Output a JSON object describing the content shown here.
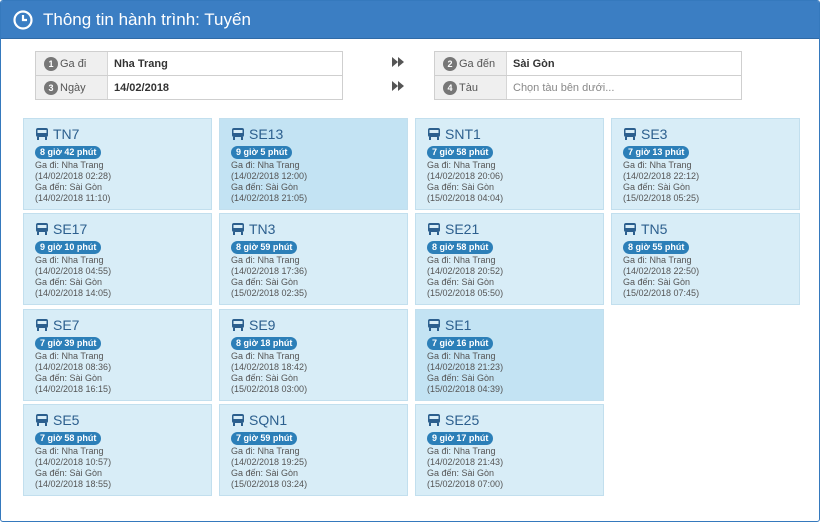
{
  "header": {
    "title": "Thông tin hành trình: Tuyến"
  },
  "form": {
    "from": {
      "num": "1",
      "label": "Ga đi",
      "value": "Nha Trang"
    },
    "to": {
      "num": "2",
      "label": "Ga đến",
      "value": "Sài Gòn"
    },
    "date": {
      "num": "3",
      "label": "Ngày",
      "value": "14/02/2018"
    },
    "train": {
      "num": "4",
      "label": "Tàu",
      "placeholder": "Chọn tàu bên dưới..."
    }
  },
  "cards": [
    {
      "name": "TN7",
      "duration": "8 giờ 42 phút",
      "dep_label": "Ga đi: Nha Trang",
      "dep_time": "(14/02/2018 02:28)",
      "arr_label": "Ga đến: Sài Gòn",
      "arr_time": "(14/02/2018 11:10)"
    },
    {
      "name": "SE13",
      "duration": "9 giờ 5 phút",
      "dep_label": "Ga đi: Nha Trang",
      "dep_time": "(14/02/2018 12:00)",
      "arr_label": "Ga đến: Sài Gòn",
      "arr_time": "(14/02/2018 21:05)"
    },
    {
      "name": "SNT1",
      "duration": "7 giờ 58 phút",
      "dep_label": "Ga đi: Nha Trang",
      "dep_time": "(14/02/2018 20:06)",
      "arr_label": "Ga đến: Sài Gòn",
      "arr_time": "(15/02/2018 04:04)"
    },
    {
      "name": "SE3",
      "duration": "7 giờ 13 phút",
      "dep_label": "Ga đi: Nha Trang",
      "dep_time": "(14/02/2018 22:12)",
      "arr_label": "Ga đến: Sài Gòn",
      "arr_time": "(15/02/2018 05:25)"
    },
    {
      "name": "SE17",
      "duration": "9 giờ 10 phút",
      "dep_label": "Ga đi: Nha Trang",
      "dep_time": "(14/02/2018 04:55)",
      "arr_label": "Ga đến: Sài Gòn",
      "arr_time": "(14/02/2018 14:05)"
    },
    {
      "name": "TN3",
      "duration": "8 giờ 59 phút",
      "dep_label": "Ga đi: Nha Trang",
      "dep_time": "(14/02/2018 17:36)",
      "arr_label": "Ga đến: Sài Gòn",
      "arr_time": "(15/02/2018 02:35)"
    },
    {
      "name": "SE21",
      "duration": "8 giờ 58 phút",
      "dep_label": "Ga đi: Nha Trang",
      "dep_time": "(14/02/2018 20:52)",
      "arr_label": "Ga đến: Sài Gòn",
      "arr_time": "(15/02/2018 05:50)"
    },
    {
      "name": "TN5",
      "duration": "8 giờ 55 phút",
      "dep_label": "Ga đi: Nha Trang",
      "dep_time": "(14/02/2018 22:50)",
      "arr_label": "Ga đến: Sài Gòn",
      "arr_time": "(15/02/2018 07:45)"
    },
    {
      "name": "SE7",
      "duration": "7 giờ 39 phút",
      "dep_label": "Ga đi: Nha Trang",
      "dep_time": "(14/02/2018 08:36)",
      "arr_label": "Ga đến: Sài Gòn",
      "arr_time": "(14/02/2018 16:15)"
    },
    {
      "name": "SE9",
      "duration": "8 giờ 18 phút",
      "dep_label": "Ga đi: Nha Trang",
      "dep_time": "(14/02/2018 18:42)",
      "arr_label": "Ga đến: Sài Gòn",
      "arr_time": "(15/02/2018 03:00)"
    },
    {
      "name": "SE1",
      "duration": "7 giờ 16 phút",
      "dep_label": "Ga đi: Nha Trang",
      "dep_time": "(14/02/2018 21:23)",
      "arr_label": "Ga đến: Sài Gòn",
      "arr_time": "(15/02/2018 04:39)"
    },
    {
      "name": "SE5",
      "duration": "7 giờ 58 phút",
      "dep_label": "Ga đi: Nha Trang",
      "dep_time": "(14/02/2018 10:57)",
      "arr_label": "Ga đến: Sài Gòn",
      "arr_time": "(14/02/2018 18:55)"
    },
    {
      "name": "SQN1",
      "duration": "7 giờ 59 phút",
      "dep_label": "Ga đi: Nha Trang",
      "dep_time": "(14/02/2018 19:25)",
      "arr_label": "Ga đến: Sài Gòn",
      "arr_time": "(15/02/2018 03:24)"
    },
    {
      "name": "SE25",
      "duration": "9 giờ 17 phút",
      "dep_label": "Ga đi: Nha Trang",
      "dep_time": "(14/02/2018 21:43)",
      "arr_label": "Ga đến: Sài Gòn",
      "arr_time": "(15/02/2018 07:00)"
    }
  ]
}
